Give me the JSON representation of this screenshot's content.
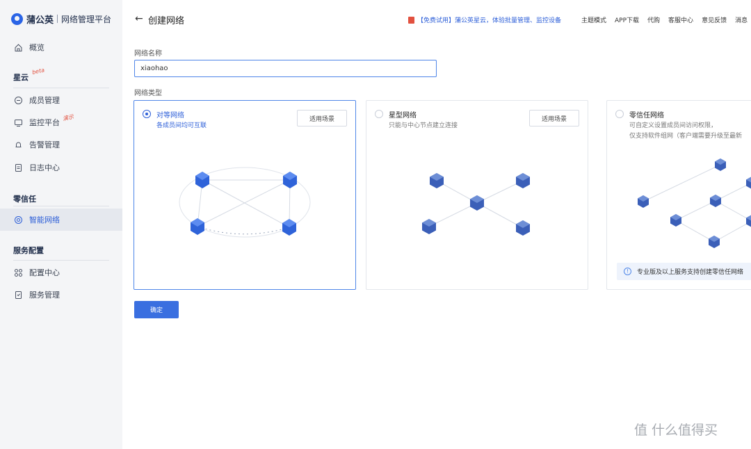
{
  "brand": {
    "name": "蒲公英",
    "platform": "网络管理平台"
  },
  "sidebar": {
    "overview": "概览",
    "groups": [
      {
        "title": "星云",
        "tag": "beta"
      },
      {
        "title": "零信任"
      },
      {
        "title": "服务配置"
      }
    ],
    "items": [
      {
        "label": "成员管理"
      },
      {
        "label": "监控平台",
        "tag": "演示"
      },
      {
        "label": "告警管理"
      },
      {
        "label": "日志中心"
      },
      {
        "label": "智能网络"
      },
      {
        "label": "配置中心"
      },
      {
        "label": "服务管理"
      }
    ]
  },
  "header": {
    "title": "创建网络",
    "promo": "【免费试用】蒲公英星云，体验批量管理、监控设备",
    "links": [
      "主题模式",
      "APP下载",
      "代购",
      "客服中心",
      "意见反馈",
      "消息"
    ]
  },
  "form": {
    "name_label": "网络名称",
    "name_value": "xiaohao",
    "type_label": "网络类型",
    "confirm": "确定"
  },
  "network_types": [
    {
      "title": "对等网络",
      "desc": "各成员间均可互联",
      "button": "适用场景",
      "selected": true
    },
    {
      "title": "星型网络",
      "desc": "只能与中心节点建立连接",
      "button": "适用场景",
      "selected": false
    },
    {
      "title": "零信任网络",
      "desc": "可自定义设置成员间访问权限，\n仅支持软件组网（客户端需要升级至最新",
      "selected": false,
      "notice": "专业版及以上服务支持创建零信任网络"
    }
  ],
  "watermark": "值 什么值得买"
}
